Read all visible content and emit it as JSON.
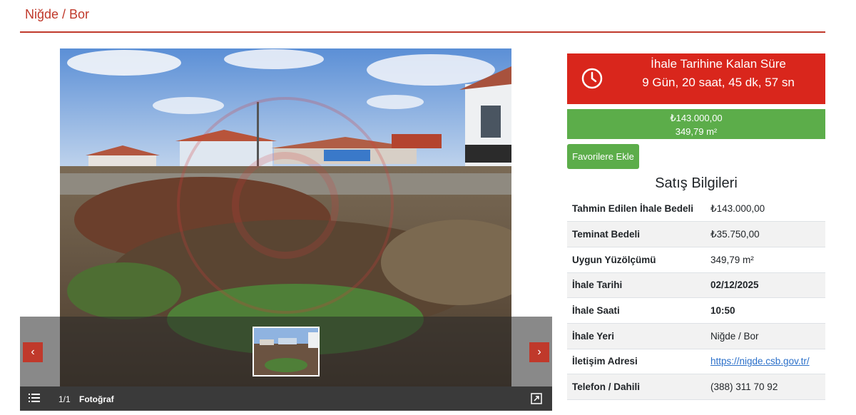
{
  "header": {
    "title": "Niğde / Bor"
  },
  "gallery": {
    "counter": "1/1",
    "media_type": "Fotoğraf",
    "prev_icon": "chevron-left-icon",
    "next_icon": "chevron-right-icon"
  },
  "countdown": {
    "label": "İhale Tarihine Kalan Süre",
    "value": "9 Gün, 20 saat, 45 dk, 57 sn",
    "color": "#d9261c"
  },
  "price": {
    "amount": "₺143.000,00",
    "area": "349,79 m²",
    "color": "#5cad4a"
  },
  "favorite_button": {
    "label": "Favorilere Ekle"
  },
  "sale_info": {
    "title": "Satış Bilgileri",
    "rows": [
      {
        "key": "Tahmin Edilen İhale Bedeli",
        "value": "₺143.000,00"
      },
      {
        "key": "Teminat Bedeli",
        "value": "₺35.750,00"
      },
      {
        "key": "Uygun Yüzölçümü",
        "value": "349,79 m²"
      },
      {
        "key": "İhale Tarihi",
        "value": "02/12/2025"
      },
      {
        "key": "İhale Saati",
        "value": "10:50"
      },
      {
        "key": "İhale Yeri",
        "value": "Niğde / Bor"
      },
      {
        "key": "İletişim Adresi",
        "value": "https://nigde.csb.gov.tr/"
      },
      {
        "key": "Telefon / Dahili",
        "value": "(388) 311 70 92"
      }
    ]
  }
}
